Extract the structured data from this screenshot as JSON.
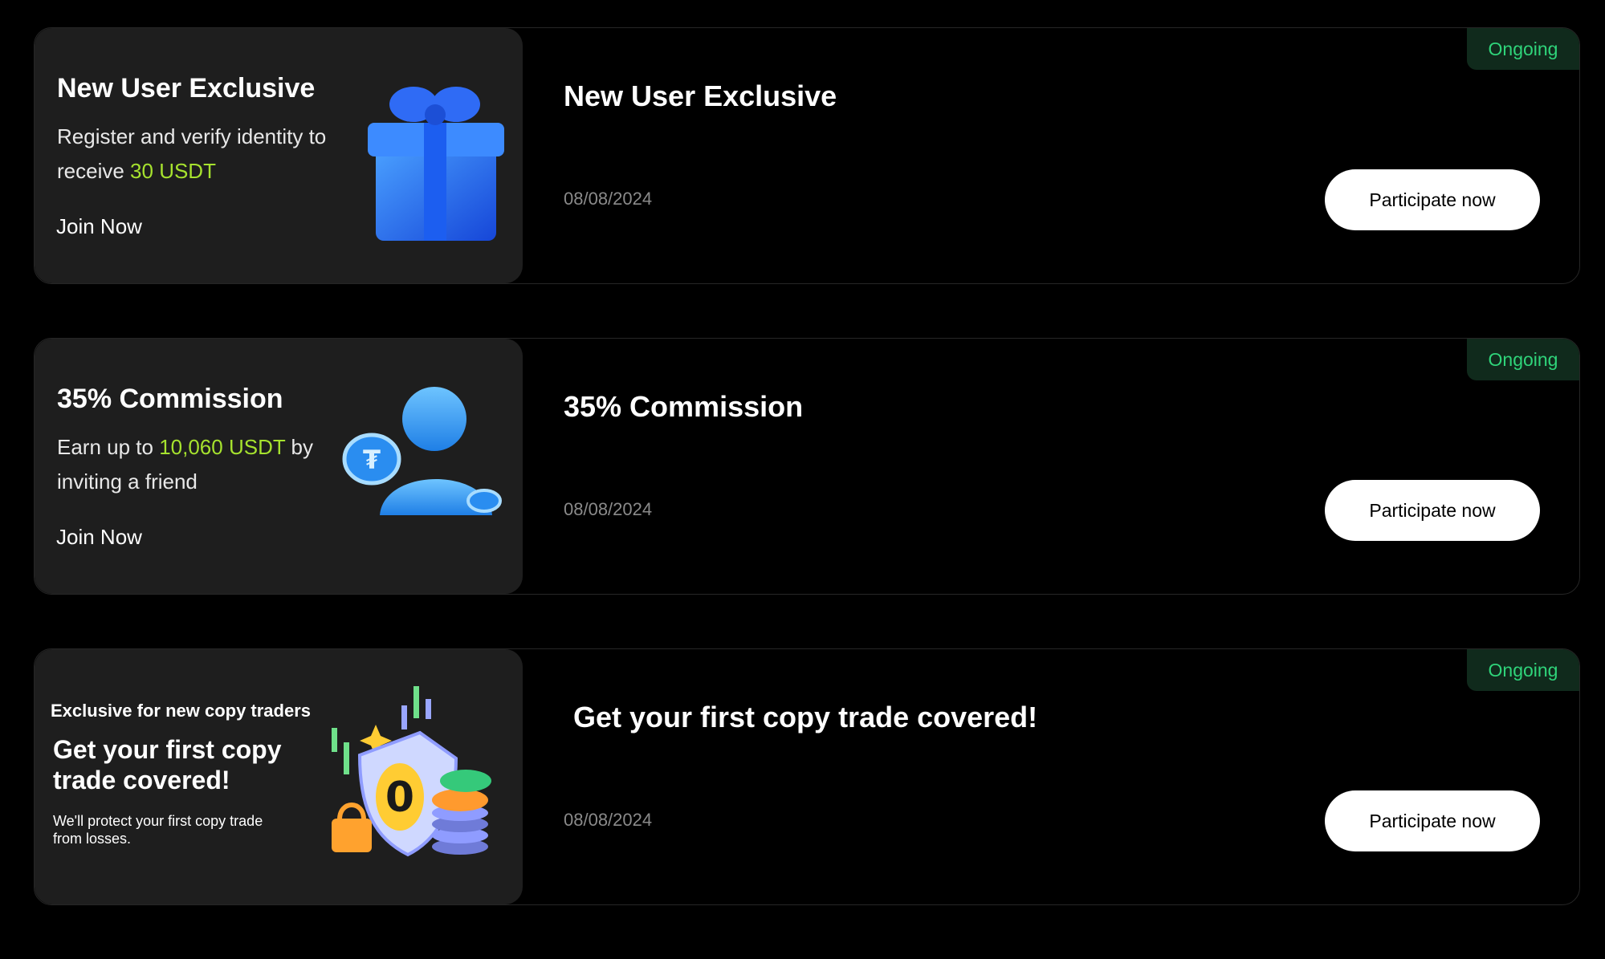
{
  "colors": {
    "background": "#000000",
    "banner_background": "#1e1e1e",
    "highlight": "#a6e22e",
    "status_text": "#2fd47a",
    "status_background": "#102a1c",
    "button_background": "#ffffff",
    "date_text": "#8a8a8a"
  },
  "promotions": [
    {
      "banner": {
        "title": "New User Exclusive",
        "desc_prefix": "Register and verify identity to receive ",
        "desc_highlight": "30 USDT",
        "desc_suffix": "",
        "join_label": "Join Now",
        "art_icon": "gift-box-icon"
      },
      "title": "New User Exclusive",
      "date": "08/08/2024",
      "cta_label": "Participate now",
      "status": "Ongoing"
    },
    {
      "banner": {
        "title": "35% Commission",
        "desc_prefix": "Earn up to ",
        "desc_highlight": "10,060 USDT",
        "desc_suffix": " by inviting a friend",
        "join_label": "Join Now",
        "art_icon": "user-with-coins-icon"
      },
      "title": "35% Commission",
      "date": "08/08/2024",
      "cta_label": "Participate now",
      "status": "Ongoing"
    },
    {
      "banner": {
        "kicker": "Exclusive for new copy traders",
        "headline": "Get your first copy trade covered!",
        "small": "We'll protect your first copy trade from losses.",
        "art_icon": "shield-coins-icon"
      },
      "title": "Get your first copy trade covered!",
      "date": "08/08/2024",
      "cta_label": "Participate now",
      "status": "Ongoing"
    }
  ]
}
